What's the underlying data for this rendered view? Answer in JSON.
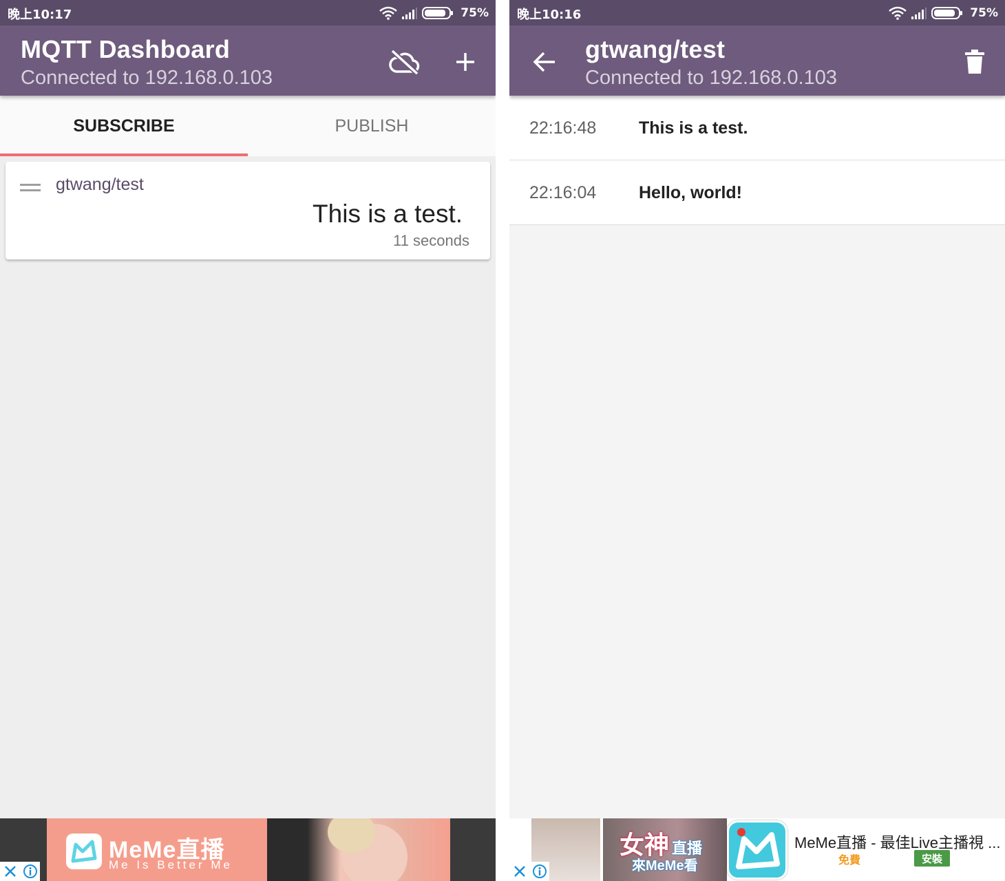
{
  "left_screen": {
    "status_bar": {
      "time": "晚上10:17",
      "battery": "75%"
    },
    "app_bar": {
      "title": "MQTT Dashboard",
      "subtitle": "Connected to 192.168.0.103",
      "icons": [
        "cloud-off-icon",
        "add-icon"
      ]
    },
    "tabs": [
      {
        "label": "SUBSCRIBE",
        "selected": true
      },
      {
        "label": "PUBLISH",
        "selected": false
      }
    ],
    "subscription_card": {
      "topic": "gtwang/test",
      "message": "This is a test.",
      "age": "11 seconds"
    },
    "ad": {
      "brand": "MeMe直播",
      "tagline": "Me Is Better Me"
    }
  },
  "right_screen": {
    "status_bar": {
      "time": "晚上10:16",
      "battery": "75%"
    },
    "app_bar": {
      "title": "gtwang/test",
      "subtitle": "Connected to 192.168.0.103",
      "icons": [
        "back-arrow-icon",
        "trash-icon"
      ]
    },
    "messages": [
      {
        "time": "22:16:48",
        "text": "This is a test."
      },
      {
        "time": "22:16:04",
        "text": "Hello, world!"
      }
    ],
    "ad": {
      "goddess": "女神",
      "live": "直播",
      "meme": "來MeMe看",
      "title": "MeMe直播 - 最佳Live主播視 ...",
      "free": "免費",
      "install": "安裝"
    }
  },
  "colors": {
    "status_bar": "#5a4c68",
    "app_bar": "#6e5b7d",
    "tab_indicator": "#ef6d73",
    "topic_text": "#5a4c68",
    "background_left": "#eeeeee",
    "background_right": "#f4f4f4"
  }
}
